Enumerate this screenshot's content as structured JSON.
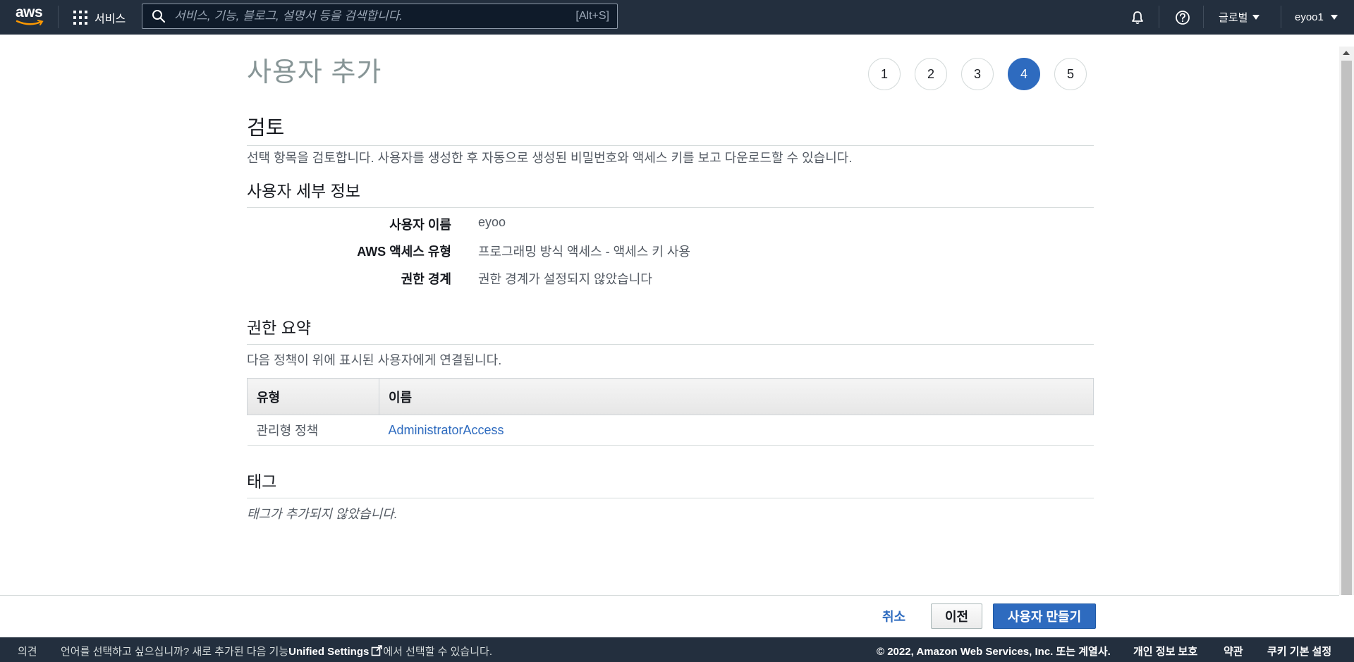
{
  "topnav": {
    "logo_text": "aws",
    "services_label": "서비스",
    "search_placeholder": "서비스, 기능, 블로그, 설명서 등을 검색합니다.",
    "search_shortcut": "[Alt+S]",
    "region_label": "글로벌",
    "account_label": "eyoo1",
    "icons": [
      "bell-icon",
      "help-icon",
      "grid-icon",
      "search-icon"
    ]
  },
  "page": {
    "title": "사용자 추가",
    "steps": [
      "1",
      "2",
      "3",
      "4",
      "5"
    ],
    "active_step": "4"
  },
  "review": {
    "heading": "검토",
    "description": "선택 항목을 검토합니다. 사용자를 생성한 후 자동으로 생성된 비밀번호와 액세스 키를 보고 다운로드할 수 있습니다."
  },
  "user_details": {
    "heading": "사용자 세부 정보",
    "rows": [
      {
        "key": "사용자 이름",
        "value": "eyoo"
      },
      {
        "key": "AWS 액세스 유형",
        "value": "프로그래밍 방식 액세스 - 액세스 키 사용"
      },
      {
        "key": "권한 경계",
        "value": "권한 경계가 설정되지 않았습니다"
      }
    ]
  },
  "permissions": {
    "heading": "권한 요약",
    "description": "다음 정책이 위에 표시된 사용자에게 연결됩니다.",
    "columns": [
      "유형",
      "이름"
    ],
    "rows": [
      {
        "type": "관리형 정책",
        "name": "AdministratorAccess"
      }
    ]
  },
  "tags": {
    "heading": "태그",
    "empty_text": "태그가 추가되지 않았습니다."
  },
  "actions": {
    "cancel": "취소",
    "previous": "이전",
    "create": "사용자 만들기"
  },
  "footer": {
    "feedback": "의견",
    "language_prefix": "언어를 선택하고 싶으십니까? 새로 추가된 다음 기능",
    "language_link": "Unified Settings",
    "language_suffix": "에서 선택할 수 있습니다.",
    "copyright": "© 2022, Amazon Web Services, Inc. 또는 계열사.",
    "privacy": "개인 정보 보호",
    "terms": "약관",
    "cookies": "쿠키 기본 설정"
  },
  "colors": {
    "nav_bg": "#232f3e",
    "primary": "#2e6bbf",
    "link": "#2e6bbf"
  }
}
